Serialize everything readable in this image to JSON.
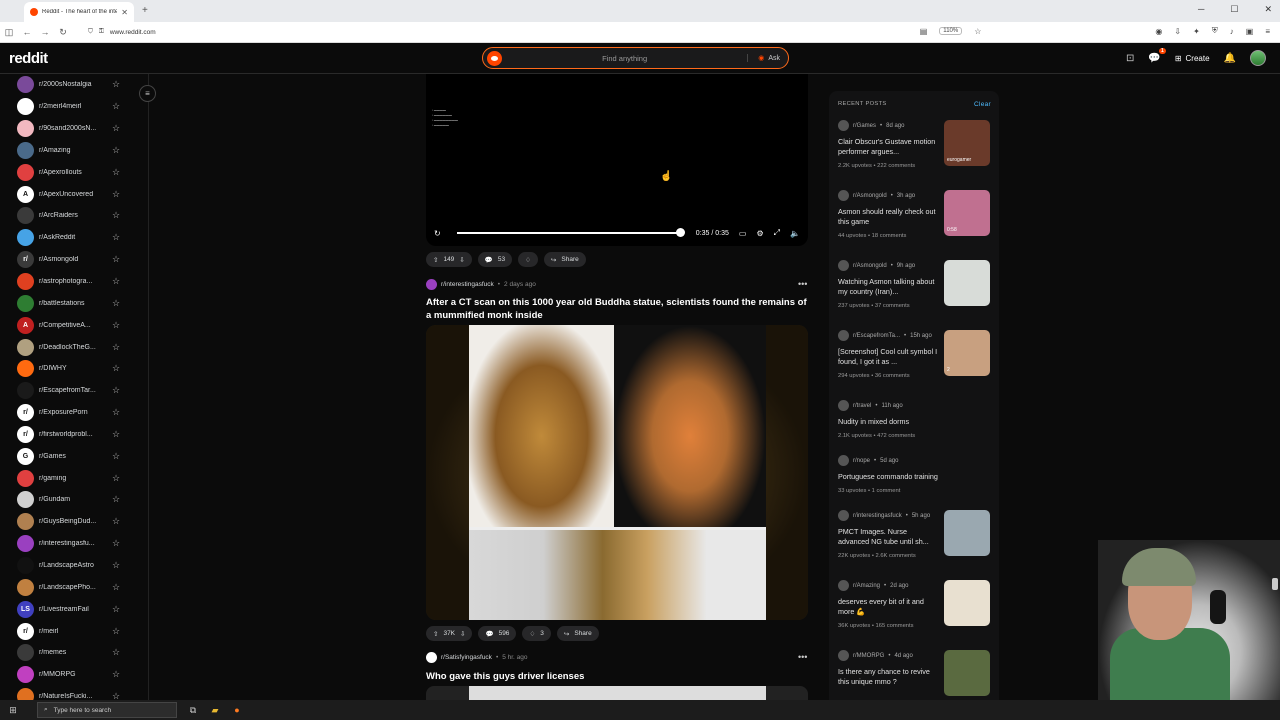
{
  "browser": {
    "tab_title": "Reddit - The heart of the intern",
    "url": "www.reddit.com",
    "zoom": "110%"
  },
  "header": {
    "logo": "reddit",
    "search_placeholder": "Find anything",
    "ask_label": "Ask",
    "create_label": "Create",
    "chat_badge": "1"
  },
  "sidebar": {
    "items": [
      {
        "name": "r/2000sNostalgia",
        "color": "#7a4a9a",
        "glyph": ""
      },
      {
        "name": "r/2meirl4meirl",
        "color": "#ffffff",
        "glyph": ""
      },
      {
        "name": "r/90sand2000sN...",
        "color": "#f2b8c0",
        "glyph": ""
      },
      {
        "name": "r/Amazing",
        "color": "#4a6a8a",
        "glyph": ""
      },
      {
        "name": "r/Apexrollouts",
        "color": "#e04040",
        "glyph": ""
      },
      {
        "name": "r/ApexUncovered",
        "color": "#ffffff",
        "glyph": "A"
      },
      {
        "name": "r/ArcRaiders",
        "color": "#3a3a3a",
        "glyph": ""
      },
      {
        "name": "r/AskReddit",
        "color": "#46a3e6",
        "glyph": ""
      },
      {
        "name": "r/Asmongold",
        "color": "#3a3a3a",
        "glyph": "r/"
      },
      {
        "name": "r/astrophotogra...",
        "color": "#e04020",
        "glyph": ""
      },
      {
        "name": "r/battlestations",
        "color": "#2e7d32",
        "glyph": ""
      },
      {
        "name": "r/CompetitiveA...",
        "color": "#c02020",
        "glyph": "A"
      },
      {
        "name": "r/DeadlockTheG...",
        "color": "#b0a080",
        "glyph": ""
      },
      {
        "name": "r/DIWHY",
        "color": "#ff6a10",
        "glyph": ""
      },
      {
        "name": "r/EscapefromTar...",
        "color": "#1a1a1a",
        "glyph": ""
      },
      {
        "name": "r/ExposurePorn",
        "color": "#ffffff",
        "glyph": "r/"
      },
      {
        "name": "r/firstworldprobl...",
        "color": "#ffffff",
        "glyph": "r/"
      },
      {
        "name": "r/Games",
        "color": "#ffffff",
        "glyph": "G"
      },
      {
        "name": "r/gaming",
        "color": "#e04040",
        "glyph": ""
      },
      {
        "name": "r/Gundam",
        "color": "#d0d0d0",
        "glyph": ""
      },
      {
        "name": "r/GuysBeingDud...",
        "color": "#b08050",
        "glyph": ""
      },
      {
        "name": "r/interestingasfu...",
        "color": "#9a40c0",
        "glyph": ""
      },
      {
        "name": "r/LandscapeAstro",
        "color": "#111111",
        "glyph": ""
      },
      {
        "name": "r/LandscapePho...",
        "color": "#c08040",
        "glyph": ""
      },
      {
        "name": "r/LivestreamFail",
        "color": "#4040c0",
        "glyph": "LS"
      },
      {
        "name": "r/meirl",
        "color": "#ffffff",
        "glyph": "r/"
      },
      {
        "name": "r/memes",
        "color": "#3a3a3a",
        "glyph": ""
      },
      {
        "name": "r/MMORPG",
        "color": "#c040c0",
        "glyph": ""
      },
      {
        "name": "r/NatureIsFucki...",
        "color": "#e07020",
        "glyph": ""
      }
    ]
  },
  "video_post": {
    "time": "0:35 / 0:35",
    "upvotes": "149",
    "comments": "53",
    "share": "Share",
    "progress": 1.0
  },
  "post1": {
    "subreddit": "r/interestingasfuck",
    "age": "2 days ago",
    "title": "After a CT scan on this 1000 year old Buddha statue, scientists found the remains of a mummified monk inside",
    "upvotes": "37K",
    "comments": "596",
    "awards": "3",
    "share": "Share"
  },
  "post2": {
    "subreddit": "r/Satisfyingasfuck",
    "age": "5 hr. ago",
    "title": "Who gave this guys driver licenses"
  },
  "recent": {
    "heading": "RECENT POSTS",
    "clear": "Clear",
    "posts": [
      {
        "sub": "r/Games",
        "age": "8d ago",
        "title": "Clair Obscur's Gustave motion performer argues...",
        "upvotes": "2.2K upvotes",
        "comments": "222 comments",
        "thumb": "#6a3a2a",
        "thumb_label": "eurogamer"
      },
      {
        "sub": "r/Asmongold",
        "age": "3h ago",
        "title": "Asmon should really check out this game",
        "upvotes": "44 upvotes",
        "comments": "18 comments",
        "thumb": "#c07090",
        "thumb_label": "0:58"
      },
      {
        "sub": "r/Asmongold",
        "age": "9h ago",
        "title": "Watching Asmon talking about my country (Iran)...",
        "upvotes": "237 upvotes",
        "comments": "37 comments",
        "thumb": "#d8dcd8",
        "thumb_label": ""
      },
      {
        "sub": "r/EscapefromTa...",
        "age": "15h ago",
        "title": "[Screenshot] Cool cult symbol I found, I got it as ...",
        "upvotes": "294 upvotes",
        "comments": "36 comments",
        "thumb": "#c8a080",
        "thumb_label": "2"
      },
      {
        "sub": "r/travel",
        "age": "11h ago",
        "title": "Nudity in mixed dorms",
        "upvotes": "2.1K upvotes",
        "comments": "472 comments",
        "thumb": "",
        "thumb_label": ""
      },
      {
        "sub": "r/nope",
        "age": "5d ago",
        "title": "Portuguese commando training",
        "upvotes": "33 upvotes",
        "comments": "1 comment",
        "thumb": "",
        "thumb_label": ""
      },
      {
        "sub": "r/interestingasfuck",
        "age": "5h ago",
        "title": "PMCT Images. Nurse advanced NG tube until sh...",
        "upvotes": "22K upvotes",
        "comments": "2.6K comments",
        "thumb": "#9aa8b0",
        "thumb_label": ""
      },
      {
        "sub": "r/Amazing",
        "age": "2d ago",
        "title": "deserves every bit of it and more 💪",
        "upvotes": "36K upvotes",
        "comments": "165 comments",
        "thumb": "#e8e0d0",
        "thumb_label": ""
      },
      {
        "sub": "r/MMORPG",
        "age": "4d ago",
        "title": "Is there any chance to revive this unique mmo ?",
        "upvotes": "",
        "comments": "",
        "thumb": "#5a6a40",
        "thumb_label": ""
      }
    ]
  },
  "taskbar": {
    "search_placeholder": "Type here to search"
  }
}
